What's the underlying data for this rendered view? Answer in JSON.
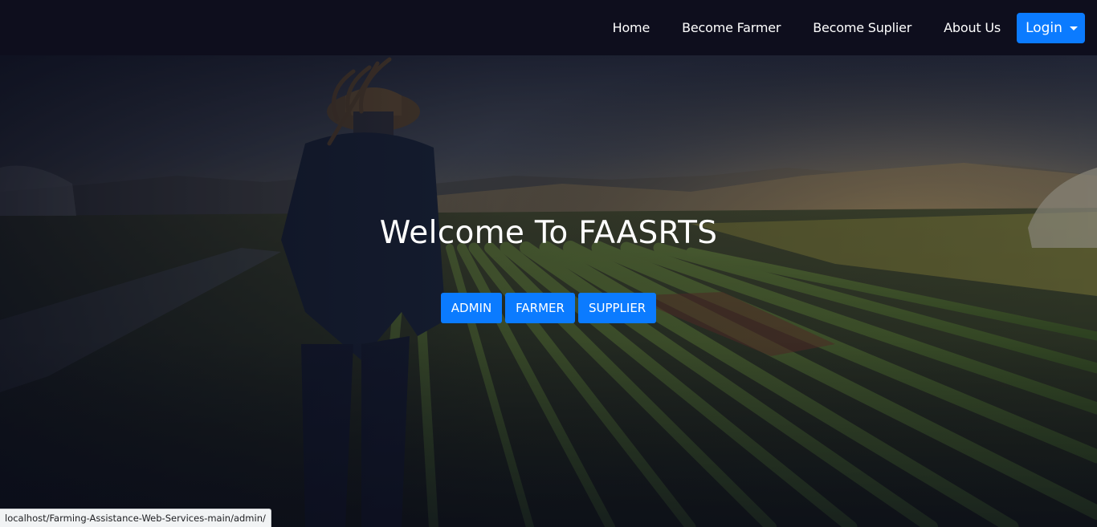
{
  "navbar": {
    "links": [
      {
        "label": "Home"
      },
      {
        "label": "Become Farmer"
      },
      {
        "label": "Become Suplier"
      },
      {
        "label": "About Us"
      }
    ],
    "login_label": "Login",
    "background": "#0e0e1d"
  },
  "hero": {
    "title": "Welcome To FAASRTS",
    "buttons": [
      {
        "label": "ADMIN"
      },
      {
        "label": "FARMER"
      },
      {
        "label": "SUPPLIER"
      }
    ],
    "button_color": "#0b7bff"
  },
  "status_bar": {
    "url": "localhost/Farming-Assistance-Web-Services-main/admin/"
  }
}
